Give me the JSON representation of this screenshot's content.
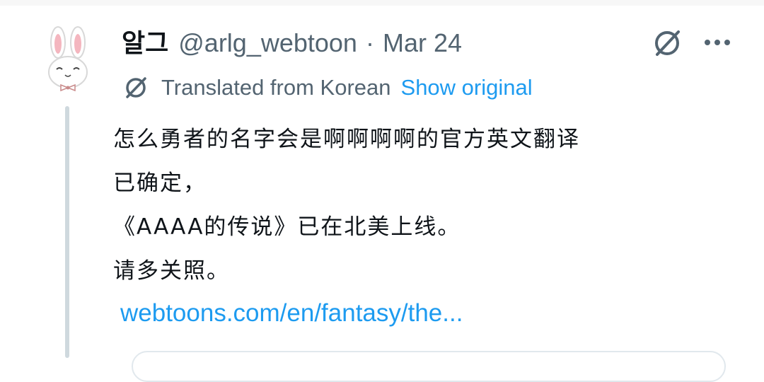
{
  "tweet": {
    "author_name": "알그",
    "handle": "@arlg_webtoon",
    "separator": "·",
    "date": "Mar 24",
    "avatar_icon": "bunny-avatar-icon",
    "grok_icon": "grok-icon",
    "more_icon": "more-dots-icon",
    "more_glyph": "•••",
    "translation": {
      "icon": "grok-icon",
      "label": "Translated from Korean",
      "show_original": "Show original"
    },
    "body_lines": [
      "怎么勇者的名字会是啊啊啊啊的官方英文翻译",
      "已确定，",
      "《AAAA的传说》已在北美上线。",
      "请多关照。"
    ],
    "link": "webtoons.com/en/fantasy/the..."
  },
  "colors": {
    "text_primary": "#0f1419",
    "text_secondary": "#536471",
    "link": "#1d9bf0",
    "thread_line": "#cfd9de",
    "bunny_ear_inner": "#f4b6bf"
  }
}
